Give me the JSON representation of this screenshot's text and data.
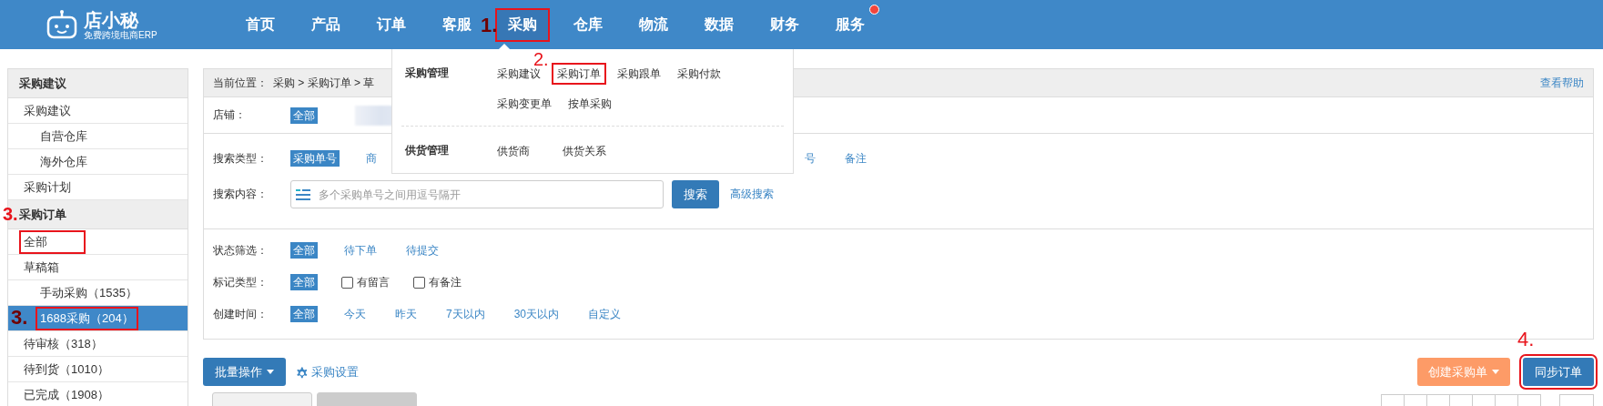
{
  "header": {
    "logo": {
      "name": "店小秘",
      "tagline": "免费跨境电商ERP"
    },
    "nav": [
      {
        "label": "首页",
        "selected": false,
        "boxed": false,
        "dot": false
      },
      {
        "label": "产品",
        "selected": false,
        "boxed": false,
        "dot": false
      },
      {
        "label": "订单",
        "selected": false,
        "boxed": false,
        "dot": false
      },
      {
        "label": "客服",
        "selected": false,
        "boxed": false,
        "dot": false
      },
      {
        "label": "采购",
        "selected": true,
        "boxed": true,
        "dot": false,
        "annotation": "1."
      },
      {
        "label": "仓库",
        "selected": false,
        "boxed": false,
        "dot": false
      },
      {
        "label": "物流",
        "selected": false,
        "boxed": false,
        "dot": false
      },
      {
        "label": "数据",
        "selected": false,
        "boxed": false,
        "dot": false
      },
      {
        "label": "财务",
        "selected": false,
        "boxed": false,
        "dot": false
      },
      {
        "label": "服务",
        "selected": false,
        "boxed": false,
        "dot": true
      }
    ]
  },
  "menu": {
    "sections": [
      {
        "title": "采购管理",
        "items": [
          {
            "label": "采购建议",
            "boxed": false
          },
          {
            "label": "采购订单",
            "boxed": true,
            "annotation": "2."
          },
          {
            "label": "采购跟单",
            "boxed": false
          },
          {
            "label": "采购付款",
            "boxed": false
          },
          {
            "label": "采购变更单",
            "boxed": false
          },
          {
            "label": "按单采购",
            "boxed": false
          }
        ]
      },
      {
        "title": "供货管理",
        "items": [
          {
            "label": "供货商",
            "boxed": false
          },
          {
            "label": "供货关系",
            "boxed": false
          }
        ]
      }
    ]
  },
  "sidebar": {
    "groups": [
      {
        "title": "采购建议",
        "items": [
          {
            "label": "采购建议",
            "selected": false,
            "boxed": false,
            "children": [
              {
                "label": "自营仓库",
                "selected": false,
                "boxed": false
              },
              {
                "label": "海外仓库",
                "selected": false,
                "boxed": false
              }
            ]
          },
          {
            "label": "采购计划",
            "selected": false,
            "boxed": false
          }
        ]
      },
      {
        "title": "采购订单",
        "annotation": "3.",
        "items": [
          {
            "label": "全部",
            "selected": false,
            "boxed": true
          },
          {
            "label": "草稿箱",
            "selected": false,
            "boxed": false,
            "children": [
              {
                "label": "手动采购（1535）",
                "selected": false,
                "boxed": false
              },
              {
                "label": "1688采购（204）",
                "selected": true,
                "boxed": true,
                "annotation": "3."
              }
            ]
          },
          {
            "label": "待审核（318）",
            "selected": false,
            "boxed": false
          },
          {
            "label": "待到货（1010）",
            "selected": false,
            "boxed": false
          },
          {
            "label": "已完成（1908）",
            "selected": false,
            "boxed": false
          }
        ]
      }
    ]
  },
  "breadcrumb": {
    "label": "当前位置：",
    "path": "采购 > 采购订单 > 草",
    "help": "查看帮助"
  },
  "store": {
    "label": "店铺：",
    "options": [
      {
        "label": "全部",
        "selected": true
      }
    ]
  },
  "search_type": {
    "label": "搜索类型：",
    "options": [
      {
        "label": "采购单号",
        "selected": true
      },
      {
        "label": "商",
        "selected": false
      }
    ],
    "options_after_menu": [
      {
        "label": "号",
        "selected": false
      },
      {
        "label": "备注",
        "selected": false
      }
    ]
  },
  "search_content": {
    "label": "搜索内容：",
    "placeholder": "多个采购单号之间用逗号隔开",
    "button": "搜索",
    "link": "高级搜索"
  },
  "status": {
    "label": "状态筛选：",
    "options": [
      {
        "label": "全部",
        "selected": true
      },
      {
        "label": "待下单",
        "selected": false
      },
      {
        "label": "待提交",
        "selected": false
      }
    ]
  },
  "mark_type": {
    "label": "标记类型：",
    "options": [
      {
        "kind": "tag",
        "label": "全部",
        "selected": true
      },
      {
        "kind": "checkbox",
        "label": "有留言",
        "checked": false
      },
      {
        "kind": "checkbox",
        "label": "有备注",
        "checked": false
      }
    ]
  },
  "created": {
    "label": "创建时间：",
    "options": [
      {
        "label": "全部",
        "selected": true
      },
      {
        "label": "今天",
        "selected": false
      },
      {
        "label": "昨天",
        "selected": false
      },
      {
        "label": "7天以内",
        "selected": false
      },
      {
        "label": "30天以内",
        "selected": false
      },
      {
        "label": "自定义",
        "selected": false
      }
    ]
  },
  "toolbar": {
    "bulk": "批量操作",
    "settings": "采购设置",
    "create": "创建采购单",
    "sync": {
      "label": "同步订单",
      "boxed": true,
      "annotation": "4."
    }
  }
}
